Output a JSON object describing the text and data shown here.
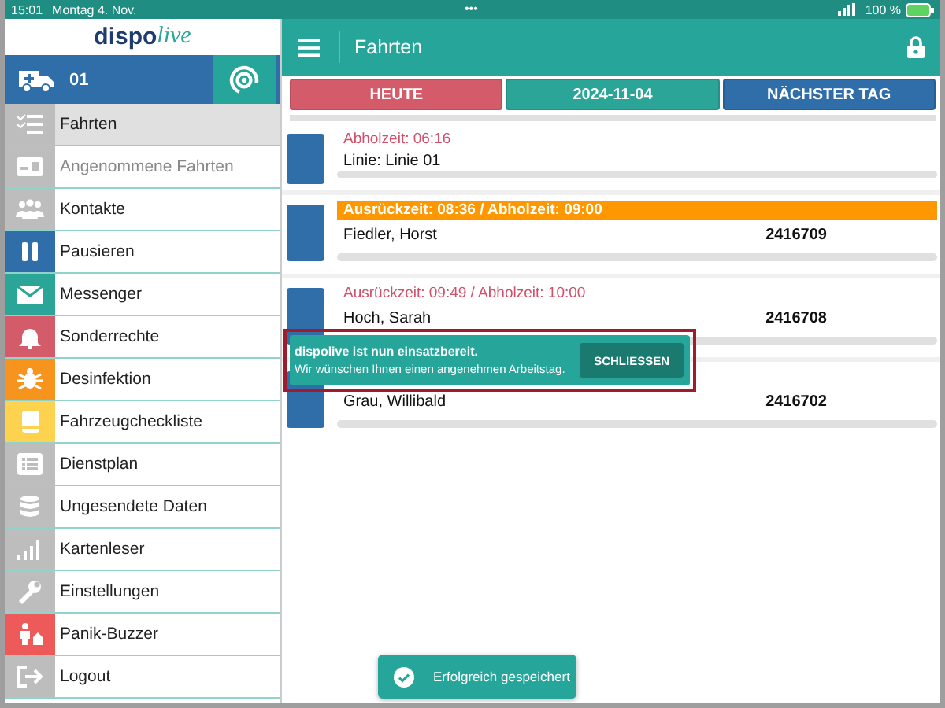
{
  "status_bar": {
    "time": "15:01",
    "date": "Montag 4. Nov.",
    "dots": "•••",
    "battery": "100 %"
  },
  "sidebar": {
    "logo": {
      "part1": "dispo",
      "part2": "live"
    },
    "vehicle": "01",
    "items": [
      {
        "label": "Fahrten",
        "selected": true,
        "disabled": false,
        "color": "#bdbdbd"
      },
      {
        "label": "Angenommene Fahrten",
        "selected": false,
        "disabled": true,
        "color": "#bdbdbd"
      },
      {
        "label": "Kontakte",
        "selected": false,
        "disabled": false,
        "color": "#bdbdbd"
      },
      {
        "label": "Pausieren",
        "selected": false,
        "disabled": false,
        "color": "#2f6ea8"
      },
      {
        "label": "Messenger",
        "selected": false,
        "disabled": false,
        "color": "#2aa597"
      },
      {
        "label": "Sonderrechte",
        "selected": false,
        "disabled": false,
        "color": "#d45c6a"
      },
      {
        "label": "Desinfektion",
        "selected": false,
        "disabled": false,
        "color": "#f7941d"
      },
      {
        "label": "Fahrzeugcheckliste",
        "selected": false,
        "disabled": false,
        "color": "#fcd24f"
      },
      {
        "label": "Dienstplan",
        "selected": false,
        "disabled": false,
        "color": "#bdbdbd"
      },
      {
        "label": "Ungesendete Daten",
        "selected": false,
        "disabled": false,
        "color": "#bdbdbd"
      },
      {
        "label": "Kartenleser",
        "selected": false,
        "disabled": false,
        "color": "#bdbdbd"
      },
      {
        "label": "Einstellungen",
        "selected": false,
        "disabled": false,
        "color": "#bdbdbd"
      },
      {
        "label": "Panik-Buzzer",
        "selected": false,
        "disabled": false,
        "color": "#ee5a5a"
      },
      {
        "label": "Logout",
        "selected": false,
        "disabled": false,
        "color": "#bdbdbd"
      }
    ]
  },
  "header": {
    "title": "Fahrten"
  },
  "day_buttons": [
    {
      "label": "HEUTE",
      "color": "#d45c6a"
    },
    {
      "label": "2024-11-04",
      "color": "#2aa597"
    },
    {
      "label": "NÄCHSTER TAG",
      "color": "#2f6ea8"
    }
  ],
  "trips": [
    {
      "header": "Abholzeit: 06:16",
      "highlight": false,
      "name": "Linie: Linie 01"
    },
    {
      "header": "Ausrückzeit: 08:36 / Abholzeit: 09:00",
      "highlight": true,
      "name": "Fiedler, Horst",
      "number": "2416709"
    },
    {
      "header": "Ausrückzeit: 09:49 / Abholzeit: 10:00",
      "highlight": false,
      "name": "Hoch, Sarah",
      "number": "2416708"
    },
    {
      "name": "Grau, Willibald",
      "number": "2416702"
    }
  ],
  "snackbar": {
    "title": "dispolive ist nun einsatzbereit.",
    "message": "Wir wünschen Ihnen einen angenehmen Arbeitstag.",
    "action": "SCHLIESSEN"
  },
  "toast": {
    "message": "Erfolgreich gespeichert"
  }
}
